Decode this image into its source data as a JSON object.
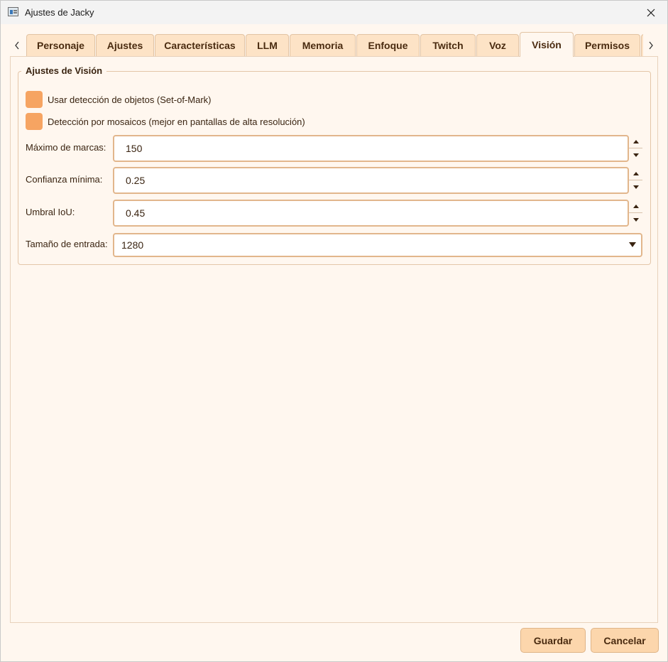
{
  "window": {
    "title": "Ajustes de Jacky"
  },
  "tabs": [
    {
      "label": "Personaje"
    },
    {
      "label": "Ajustes"
    },
    {
      "label": "Características"
    },
    {
      "label": "LLM"
    },
    {
      "label": "Memoria"
    },
    {
      "label": "Enfoque"
    },
    {
      "label": "Twitch"
    },
    {
      "label": "Voz"
    },
    {
      "label": "Visión",
      "active": true
    },
    {
      "label": "Permisos"
    }
  ],
  "vision": {
    "group_title": "Ajustes de Visión",
    "checkboxes": [
      {
        "label": "Usar detección de objetos (Set-of-Mark)",
        "checked": false
      },
      {
        "label": "Detección por mosaicos (mejor en pantallas de alta resolución)",
        "checked": false
      }
    ],
    "fields": [
      {
        "label": "Máximo de marcas:",
        "value": "150"
      },
      {
        "label": "Confianza mínima:",
        "value": "0.25"
      },
      {
        "label": "Umbral IoU:",
        "value": "0.45"
      }
    ],
    "input_size": {
      "label": "Tamaño de entrada:",
      "value": "1280"
    }
  },
  "buttons": {
    "save": "Guardar",
    "cancel": "Cancelar"
  },
  "colors": {
    "background": "#fff7ef",
    "tab": "#fde3c6",
    "checkbox": "#f6a462",
    "button": "#fcd6ac",
    "border": "#e2b68c",
    "text": "#3a2411"
  },
  "icons": {
    "close": "close-icon",
    "tab_left": "chevron-left-icon",
    "tab_right": "chevron-right-icon",
    "spin_up": "triangle-up-icon",
    "spin_down": "triangle-down-icon",
    "dropdown": "chevron-down-icon"
  }
}
